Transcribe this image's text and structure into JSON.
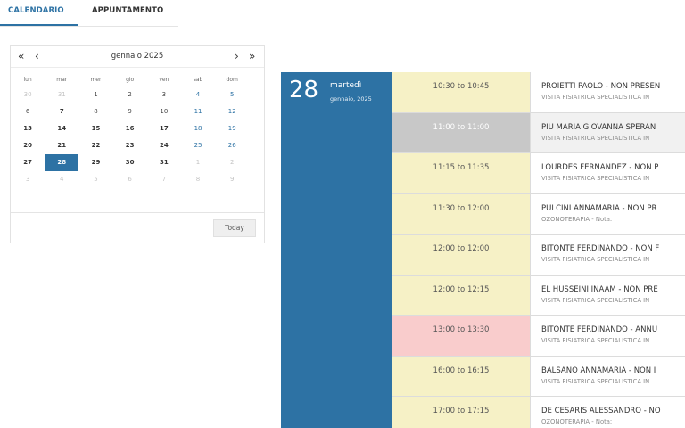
{
  "tabs": {
    "calendar": "CALENDARIO",
    "appointment": "APPUNTAMENTO"
  },
  "mini_calendar": {
    "prev_year": "«",
    "prev_month": "‹",
    "title": "gennaio 2025",
    "next_month": "›",
    "next_year": "»",
    "weekdays": [
      "lun",
      "mar",
      "mer",
      "gio",
      "ven",
      "sab",
      "dom"
    ],
    "weeks": [
      [
        "30",
        "31",
        "1",
        "2",
        "3",
        "4",
        "5"
      ],
      [
        "6",
        "7",
        "8",
        "9",
        "10",
        "11",
        "12"
      ],
      [
        "13",
        "14",
        "15",
        "16",
        "17",
        "18",
        "19"
      ],
      [
        "20",
        "21",
        "22",
        "23",
        "24",
        "25",
        "26"
      ],
      [
        "27",
        "28",
        "29",
        "30",
        "31",
        "1",
        "2"
      ],
      [
        "3",
        "4",
        "5",
        "6",
        "7",
        "8",
        "9"
      ]
    ],
    "selected_day": "28",
    "today_label": "Today"
  },
  "day": {
    "number": "28",
    "weekday": "martedì",
    "month_year": "gennaio, 2025"
  },
  "appointments": [
    {
      "time": "10:30 to 10:45",
      "title": "PROIETTI PAOLO - NON PRESEN",
      "sub": "VISITA FISIATRICA SPECIALISTICA IN",
      "status_color": "#f6f1c6"
    },
    {
      "time": "11:00 to 11:00",
      "title": "PIU MARIA GIOVANNA SPERAN",
      "sub": "VISITA FISIATRICA SPECIALISTICA IN",
      "status_color": "#c8c8c8"
    },
    {
      "time": "11:15 to 11:35",
      "title": "LOURDES FERNANDEZ - NON P",
      "sub": "VISITA FISIATRICA SPECIALISTICA IN",
      "status_color": "#f6f1c6"
    },
    {
      "time": "11:30 to 12:00",
      "title": "PULCINI ANNAMARIA - NON PR",
      "sub": "OZONOTERAPIA - Nota:",
      "status_color": "#f6f1c6"
    },
    {
      "time": "12:00 to 12:00",
      "title": "BITONTE FERDINANDO - NON F",
      "sub": "VISITA FISIATRICA SPECIALISTICA IN",
      "status_color": "#f6f1c6"
    },
    {
      "time": "12:00 to 12:15",
      "title": "EL HUSSEINI INAAM - NON PRE",
      "sub": "VISITA FISIATRICA SPECIALISTICA IN",
      "status_color": "#f6f1c6"
    },
    {
      "time": "13:00 to 13:30",
      "title": "BITONTE FERDINANDO - ANNU",
      "sub": "VISITA FISIATRICA SPECIALISTICA IN",
      "status_color": "#f9cccc"
    },
    {
      "time": "16:00 to 16:15",
      "title": "BALSANO ANNAMARIA - NON I",
      "sub": "VISITA FISIATRICA SPECIALISTICA IN",
      "status_color": "#f6f1c6"
    },
    {
      "time": "17:00 to 17:15",
      "title": "DE CESARIS ALESSANDRO - NO",
      "sub": "OZONOTERAPIA - Nota:",
      "status_color": "#f6f1c6"
    }
  ],
  "colors": {
    "accent": "#2d72a4",
    "pending": "#f6f1c6",
    "cancelled": "#f9cccc",
    "past": "#c8c8c8"
  }
}
